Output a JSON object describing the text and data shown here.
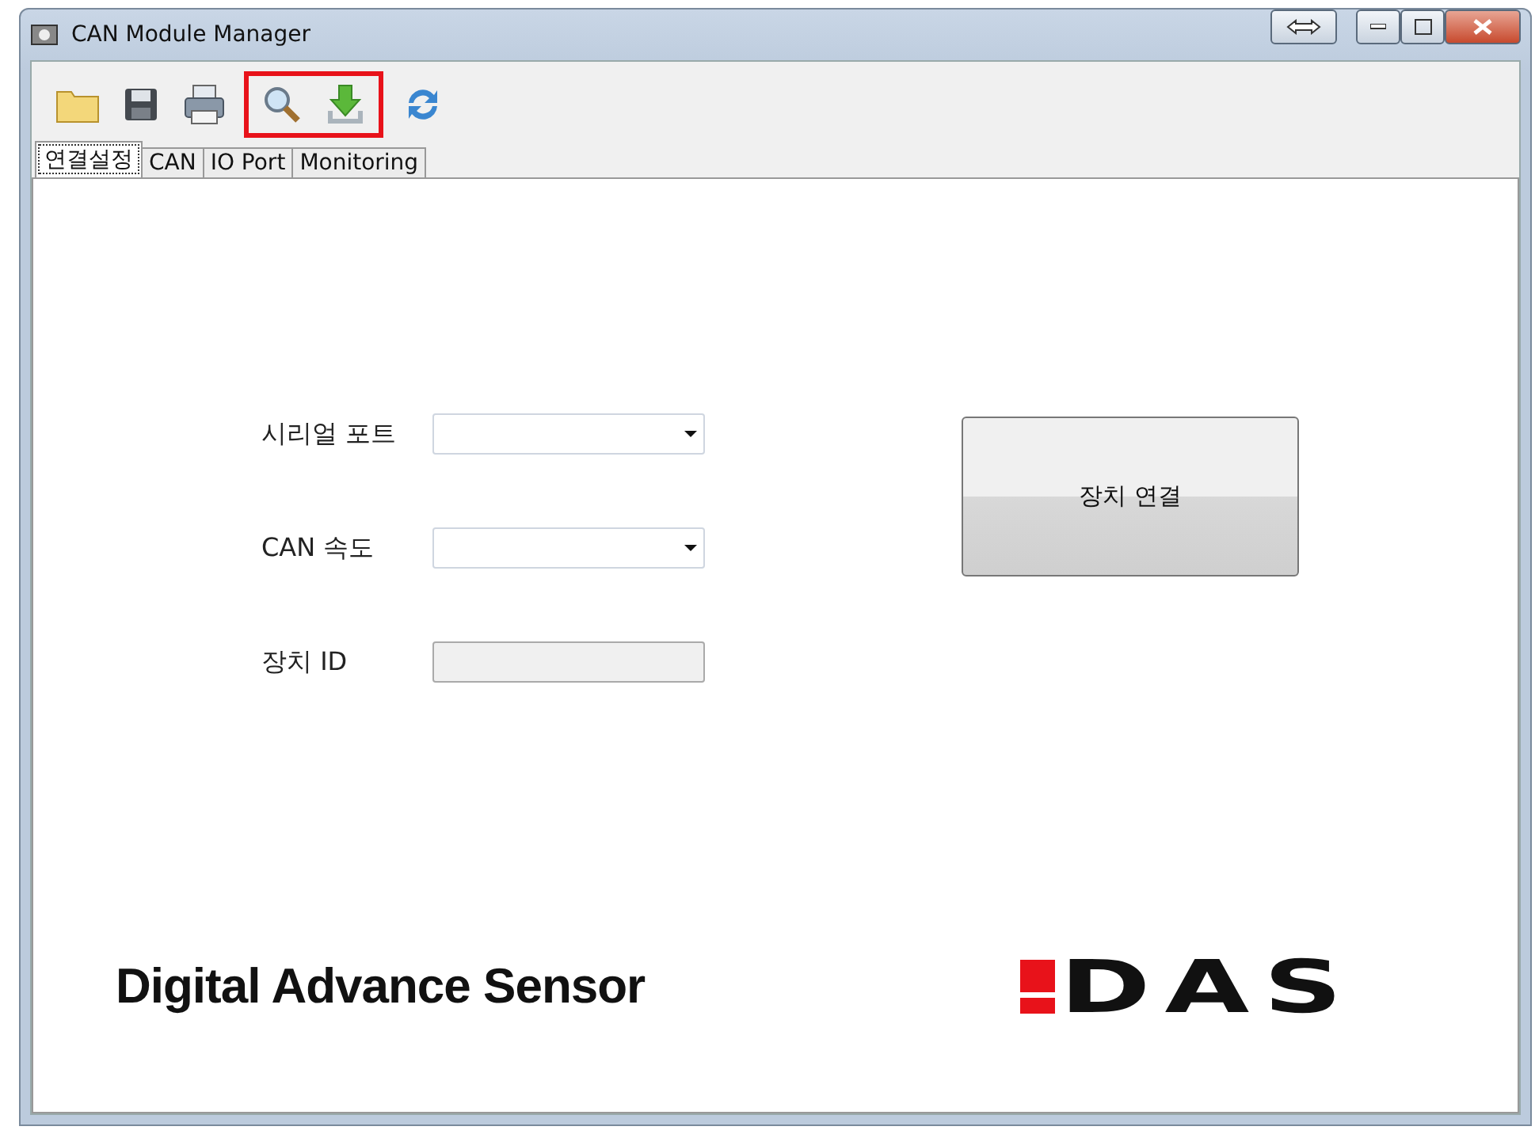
{
  "window": {
    "title": "CAN Module Manager"
  },
  "title_buttons": [
    {
      "kind": "swap"
    },
    {
      "kind": "minimize"
    },
    {
      "kind": "maximize"
    },
    {
      "kind": "close"
    }
  ],
  "toolbar": [
    {
      "kind": "open",
      "highlighted": false
    },
    {
      "kind": "save",
      "highlighted": false
    },
    {
      "kind": "print",
      "highlighted": false
    },
    {
      "kind": "search",
      "highlighted": true
    },
    {
      "kind": "download",
      "highlighted": true
    },
    {
      "kind": "refresh",
      "highlighted": false
    }
  ],
  "tabs": [
    {
      "label": "연결설정",
      "selected": true
    },
    {
      "label": "CAN",
      "selected": false
    },
    {
      "label": "IO Port",
      "selected": false
    },
    {
      "label": "Monitoring",
      "selected": false
    }
  ],
  "form": [
    {
      "label": "시리얼 포트",
      "kind": "dropdown",
      "disabled": false
    },
    {
      "label": "CAN 속도",
      "kind": "dropdown",
      "disabled": false
    },
    {
      "label": "장치 ID",
      "kind": "text",
      "disabled": true
    }
  ],
  "connect_button": {
    "label": "장치 연결"
  },
  "footer": {
    "company": "Digital Advance Sensor",
    "logo": "DAS"
  }
}
